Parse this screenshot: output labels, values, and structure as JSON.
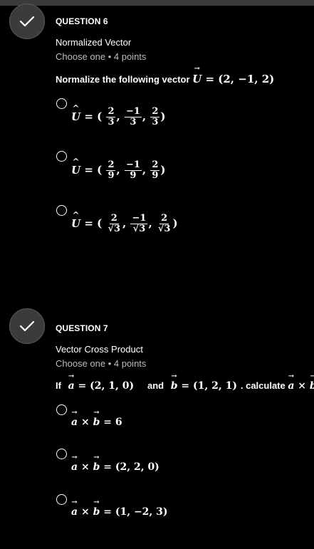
{
  "questions": [
    {
      "label": "QUESTION 6",
      "title": "Normalized Vector",
      "meta": "Choose one • 4 points",
      "prompt_text": "Normalize the following vector",
      "prompt_math": "= (2, −1, 2)",
      "prompt_vector": "U",
      "options": [
        {
          "lhs": "U",
          "fractions": [
            [
              "2",
              "3"
            ],
            [
              "−1",
              "3"
            ],
            [
              "2",
              "3"
            ]
          ]
        },
        {
          "lhs": "U",
          "fractions": [
            [
              "2",
              "9"
            ],
            [
              "−1",
              "9"
            ],
            [
              "2",
              "9"
            ]
          ]
        },
        {
          "lhs": "U",
          "fractions": [
            [
              "2",
              "√3"
            ],
            [
              "−1",
              "√3"
            ],
            [
              "2",
              "√3"
            ]
          ]
        }
      ]
    },
    {
      "label": "QUESTION 7",
      "title": "Vector Cross Product",
      "meta": "Choose one • 4 points",
      "prompt_if": "If",
      "prompt_a": "a",
      "prompt_a_val": "= (2, 1, 0)",
      "prompt_and": "and",
      "prompt_b": "b",
      "prompt_b_val": "= (1, 2, 1)",
      "prompt_calc": ". calculate",
      "options": [
        {
          "rhs": "= 6"
        },
        {
          "rhs": "= (2, 2, 0)"
        },
        {
          "rhs": "= (1, −2, 3)"
        }
      ]
    }
  ]
}
